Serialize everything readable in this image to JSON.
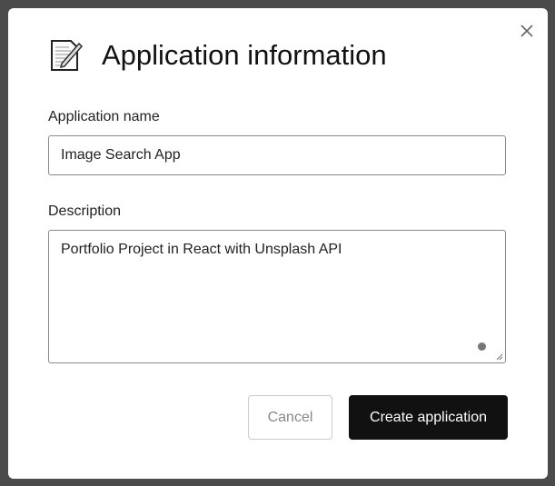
{
  "dialog": {
    "title": "Application information",
    "icon": "memo-icon",
    "close_icon": "close-icon",
    "name_label": "Application name",
    "name_value": "Image Search App",
    "description_label": "Description",
    "description_value": "Portfolio Project in React with Unsplash API",
    "cancel_label": "Cancel",
    "create_label": "Create application"
  }
}
